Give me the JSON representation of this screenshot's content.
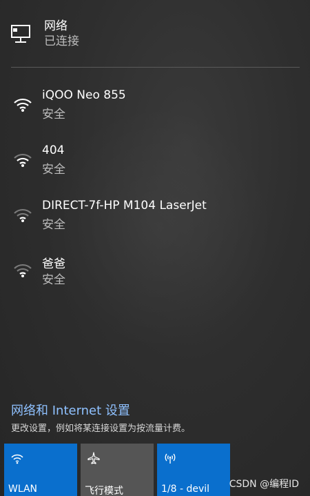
{
  "connected": {
    "title": "网络",
    "status": "已连接",
    "icon": "ethernet-network-icon"
  },
  "networks": [
    {
      "ssid": "iQOO Neo 855",
      "security": "安全",
      "icon": "wifi-signal-icon",
      "signal": "full"
    },
    {
      "ssid": "404",
      "security": "安全",
      "icon": "wifi-signal-icon",
      "signal": "medium"
    },
    {
      "ssid": "DIRECT-7f-HP M104 LaserJet",
      "security": "安全",
      "icon": "wifi-signal-icon",
      "signal": "medium"
    },
    {
      "ssid": "爸爸",
      "security": "安全",
      "icon": "wifi-signal-icon",
      "signal": "medium"
    }
  ],
  "settings": {
    "link": "网络和 Internet 设置",
    "description": "更改设置，例如将某连接设置为按流量计费。"
  },
  "quick_actions": [
    {
      "label": "WLAN",
      "icon": "wifi-icon",
      "active": true
    },
    {
      "label": "飞行模式",
      "icon": "airplane-icon",
      "active": false
    },
    {
      "label": "1/8 - devil",
      "icon": "mobile-hotspot-icon",
      "active": true
    }
  ],
  "watermark": "CSDN @编程ID",
  "colors": {
    "active_tile": "#0a6fcd",
    "inactive_tile": "#555555",
    "link": "#8fc1ff",
    "background": "#2b2b2b"
  }
}
